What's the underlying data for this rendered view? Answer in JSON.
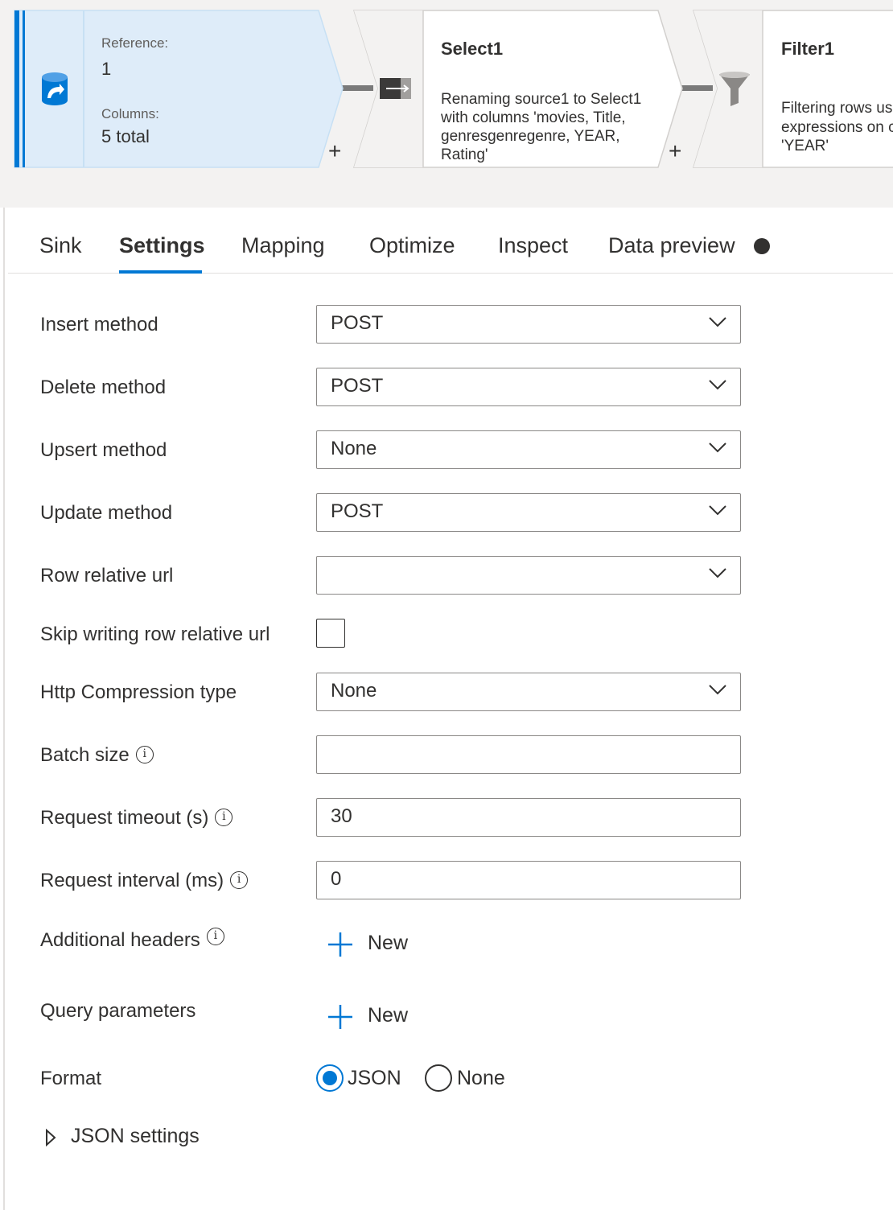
{
  "pipeline": {
    "source": {
      "reference_label": "Reference:",
      "reference_value": "1",
      "columns_label": "Columns:",
      "columns_value": "5 total",
      "icon": "database-source-icon"
    },
    "select": {
      "title": "Select1",
      "description": [
        "Renaming source1 to Select1",
        "with columns 'movies, Title,",
        "genresgenregenre, YEAR,",
        "Rating'"
      ],
      "icon": "select-transform-icon"
    },
    "filter": {
      "title": "Filter1",
      "description": [
        "Filtering rows us",
        "expressions on c",
        "'YEAR'"
      ],
      "icon": "funnel-filter-icon"
    },
    "add_symbol": "+"
  },
  "tabs": [
    {
      "label": "Sink"
    },
    {
      "label": "Settings",
      "active": true
    },
    {
      "label": "Mapping"
    },
    {
      "label": "Optimize"
    },
    {
      "label": "Inspect"
    },
    {
      "label": "Data preview"
    }
  ],
  "form": {
    "insert_method": {
      "label": "Insert method",
      "value": "POST"
    },
    "delete_method": {
      "label": "Delete method",
      "value": "POST"
    },
    "upsert_method": {
      "label": "Upsert method",
      "value": "None"
    },
    "update_method": {
      "label": "Update method",
      "value": "POST"
    },
    "row_relative_url": {
      "label": "Row relative url",
      "value": ""
    },
    "skip_writing": {
      "label": "Skip writing row relative url",
      "checked": false
    },
    "http_compression": {
      "label": "Http Compression type",
      "value": "None"
    },
    "batch_size": {
      "label": "Batch size",
      "value": ""
    },
    "request_timeout": {
      "label": "Request timeout (s)",
      "value": "30"
    },
    "request_interval": {
      "label": "Request interval (ms)",
      "value": "0"
    },
    "additional_headers": {
      "label": "Additional headers",
      "button": "New"
    },
    "query_parameters": {
      "label": "Query parameters",
      "button": "New"
    },
    "format": {
      "label": "Format",
      "options": [
        "JSON",
        "None"
      ],
      "selected": "JSON"
    },
    "json_settings": {
      "label": "JSON settings"
    }
  },
  "colors": {
    "accent": "#0078d4",
    "source_fill": "#deecf9",
    "text": "#323130"
  }
}
